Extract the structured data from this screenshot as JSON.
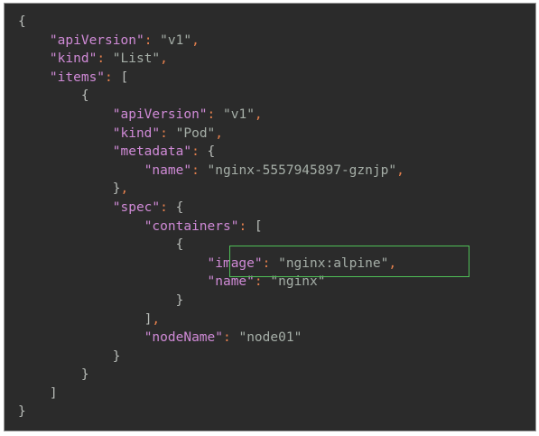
{
  "code": {
    "lines": [
      {
        "indent": "",
        "tokens": [
          {
            "t": "brace",
            "v": "{"
          }
        ]
      },
      {
        "indent": "    ",
        "tokens": [
          {
            "t": "key",
            "v": "\"apiVersion\""
          },
          {
            "t": "punc",
            "v": ": "
          },
          {
            "t": "str",
            "v": "\"v1\""
          },
          {
            "t": "punc",
            "v": ","
          }
        ]
      },
      {
        "indent": "    ",
        "tokens": [
          {
            "t": "key",
            "v": "\"kind\""
          },
          {
            "t": "punc",
            "v": ": "
          },
          {
            "t": "str",
            "v": "\"List\""
          },
          {
            "t": "punc",
            "v": ","
          }
        ]
      },
      {
        "indent": "    ",
        "tokens": [
          {
            "t": "key",
            "v": "\"items\""
          },
          {
            "t": "punc",
            "v": ": "
          },
          {
            "t": "brace",
            "v": "["
          }
        ]
      },
      {
        "indent": "        ",
        "tokens": [
          {
            "t": "brace",
            "v": "{"
          }
        ]
      },
      {
        "indent": "            ",
        "tokens": [
          {
            "t": "key",
            "v": "\"apiVersion\""
          },
          {
            "t": "punc",
            "v": ": "
          },
          {
            "t": "str",
            "v": "\"v1\""
          },
          {
            "t": "punc",
            "v": ","
          }
        ]
      },
      {
        "indent": "            ",
        "tokens": [
          {
            "t": "key",
            "v": "\"kind\""
          },
          {
            "t": "punc",
            "v": ": "
          },
          {
            "t": "str",
            "v": "\"Pod\""
          },
          {
            "t": "punc",
            "v": ","
          }
        ]
      },
      {
        "indent": "            ",
        "tokens": [
          {
            "t": "key",
            "v": "\"metadata\""
          },
          {
            "t": "punc",
            "v": ": "
          },
          {
            "t": "brace",
            "v": "{"
          }
        ]
      },
      {
        "indent": "                ",
        "tokens": [
          {
            "t": "key",
            "v": "\"name\""
          },
          {
            "t": "punc",
            "v": ": "
          },
          {
            "t": "str",
            "v": "\"nginx-5557945897-gznjp\""
          },
          {
            "t": "punc",
            "v": ","
          }
        ]
      },
      {
        "indent": "            ",
        "tokens": [
          {
            "t": "brace",
            "v": "}"
          },
          {
            "t": "punc",
            "v": ","
          }
        ]
      },
      {
        "indent": "            ",
        "tokens": [
          {
            "t": "key",
            "v": "\"spec\""
          },
          {
            "t": "punc",
            "v": ": "
          },
          {
            "t": "brace",
            "v": "{"
          }
        ]
      },
      {
        "indent": "                ",
        "tokens": [
          {
            "t": "key",
            "v": "\"containers\""
          },
          {
            "t": "punc",
            "v": ": "
          },
          {
            "t": "brace",
            "v": "["
          }
        ]
      },
      {
        "indent": "                    ",
        "tokens": [
          {
            "t": "brace",
            "v": "{"
          }
        ]
      },
      {
        "indent": "                        ",
        "tokens": [
          {
            "t": "key",
            "v": "\"image\""
          },
          {
            "t": "punc",
            "v": ": "
          },
          {
            "t": "str",
            "v": "\"nginx:alpine\""
          },
          {
            "t": "punc",
            "v": ","
          }
        ]
      },
      {
        "indent": "                        ",
        "tokens": [
          {
            "t": "key",
            "v": "\"name\""
          },
          {
            "t": "punc",
            "v": ": "
          },
          {
            "t": "str",
            "v": "\"nginx\""
          }
        ]
      },
      {
        "indent": "                    ",
        "tokens": [
          {
            "t": "brace",
            "v": "}"
          }
        ]
      },
      {
        "indent": "                ",
        "tokens": [
          {
            "t": "brace",
            "v": "]"
          },
          {
            "t": "punc",
            "v": ","
          }
        ]
      },
      {
        "indent": "                ",
        "tokens": [
          {
            "t": "key",
            "v": "\"nodeName\""
          },
          {
            "t": "punc",
            "v": ": "
          },
          {
            "t": "str",
            "v": "\"node01\""
          }
        ]
      },
      {
        "indent": "            ",
        "tokens": [
          {
            "t": "brace",
            "v": "}"
          }
        ]
      },
      {
        "indent": "        ",
        "tokens": [
          {
            "t": "brace",
            "v": "}"
          }
        ]
      },
      {
        "indent": "    ",
        "tokens": [
          {
            "t": "brace",
            "v": "]"
          }
        ]
      },
      {
        "indent": "",
        "tokens": [
          {
            "t": "brace",
            "v": "}"
          }
        ]
      }
    ]
  },
  "colors": {
    "background": "#2b2b2b",
    "key": "#cf8ad6",
    "string": "#a5aea7",
    "punctuation": "#e6804d",
    "highlight_border": "#4fbf57"
  }
}
